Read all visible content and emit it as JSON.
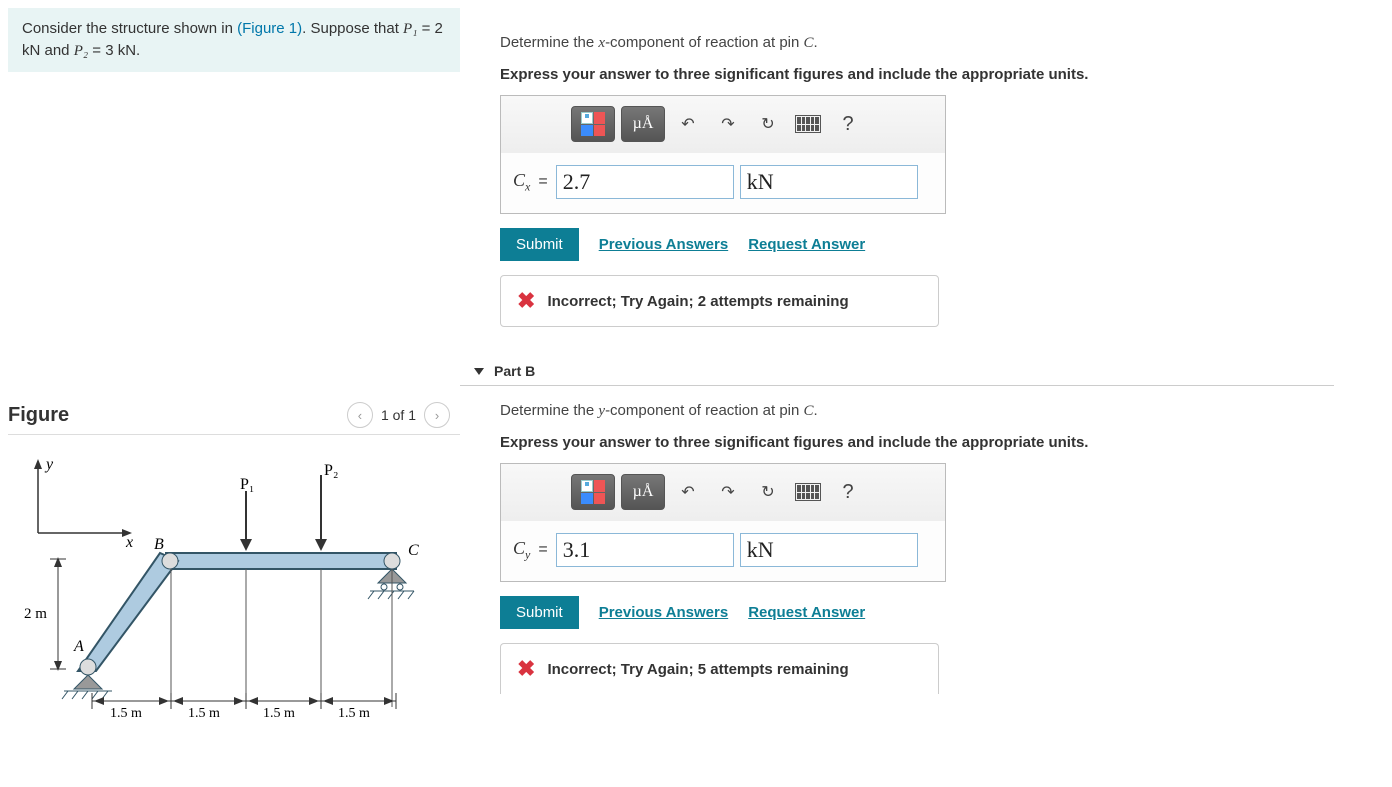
{
  "prompt": {
    "text_before": "Consider the structure shown in ",
    "fig_link": "(Figure 1)",
    "text_after": ". Suppose that ",
    "eq1_l": "P₁",
    "eq1_r": " = 2 kN and ",
    "eq2_l": "P₂",
    "eq2_r": " = 3 kN."
  },
  "figure": {
    "title": "Figure",
    "counter": "1 of 1",
    "labels": {
      "y": "y",
      "x": "x",
      "B": "B",
      "C": "C",
      "A": "A",
      "P1": "P₁",
      "P2": "P₂",
      "h": "2 m",
      "d": "1.5 m"
    }
  },
  "partA": {
    "prompt_before": "Determine the ",
    "var": "x",
    "prompt_mid": "-component of reaction at pin ",
    "pin": "C",
    "prompt_after": ".",
    "instruction": "Express your answer to three significant figures and include the appropriate units.",
    "var_label": "C",
    "var_sub": "x",
    "value": "2.7",
    "unit": "kN",
    "submit": "Submit",
    "prev": "Previous Answers",
    "req": "Request Answer",
    "feedback": "Incorrect; Try Again; 2 attempts remaining",
    "uA": "µÅ",
    "q": "?"
  },
  "partB": {
    "header": "Part B",
    "prompt_before": "Determine the ",
    "var": "y",
    "prompt_mid": "-component of reaction at pin ",
    "pin": "C",
    "prompt_after": ".",
    "instruction": "Express your answer to three significant figures and include the appropriate units.",
    "var_label": "C",
    "var_sub": "y",
    "value": "3.1",
    "unit": "kN",
    "submit": "Submit",
    "prev": "Previous Answers",
    "req": "Request Answer",
    "feedback": "Incorrect; Try Again; 5 attempts remaining",
    "uA": "µÅ",
    "q": "?"
  }
}
